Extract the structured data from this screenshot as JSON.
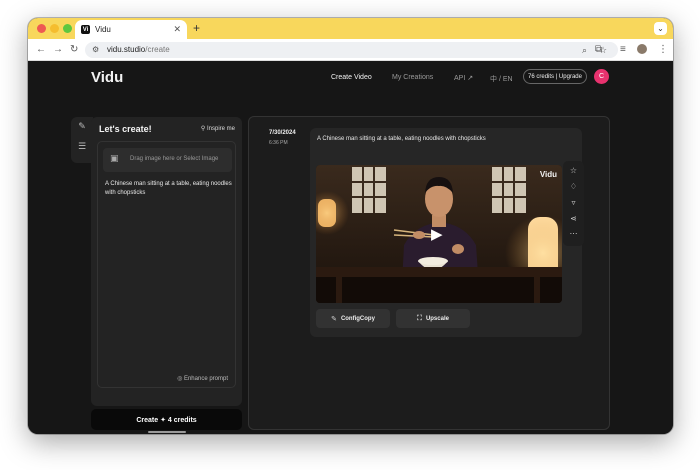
{
  "browser": {
    "tab_title": "Vidu",
    "favicon_text": "Vi",
    "new_tab": "+",
    "url_host": "vidu.studio",
    "url_path": "/create",
    "accent_color": "#f8d75c"
  },
  "header": {
    "logo": "Vidu",
    "nav": {
      "create_video": "Create Video",
      "my_creations": "My Creations",
      "api": "API ↗",
      "lang": "中 / EN"
    },
    "credits": "76 credits | Upgrade",
    "avatar_initial": "C"
  },
  "create_panel": {
    "title": "Let's create!",
    "inspire": "Inspire me",
    "upload_placeholder": "Drag image here or Select Image",
    "prompt": "A Chinese man sitting at a table, eating noodles with chopsticks",
    "enhance": "Enhance prompt",
    "create_button": "Create ✦ 4 credits"
  },
  "results": {
    "date": "7/30/2024",
    "time": "6:36 PM",
    "prompt": "A Chinese man sitting at a table, eating noodles with chopsticks",
    "watermark": "Vidu",
    "config_copy": "ConfigCopy",
    "upscale": "Upscale"
  },
  "icons": {
    "favorite": "star-icon",
    "like": "thumbs-up-icon",
    "dislike": "thumbs-down-icon",
    "share": "share-icon",
    "more": "more-icon",
    "play": "play-icon"
  }
}
